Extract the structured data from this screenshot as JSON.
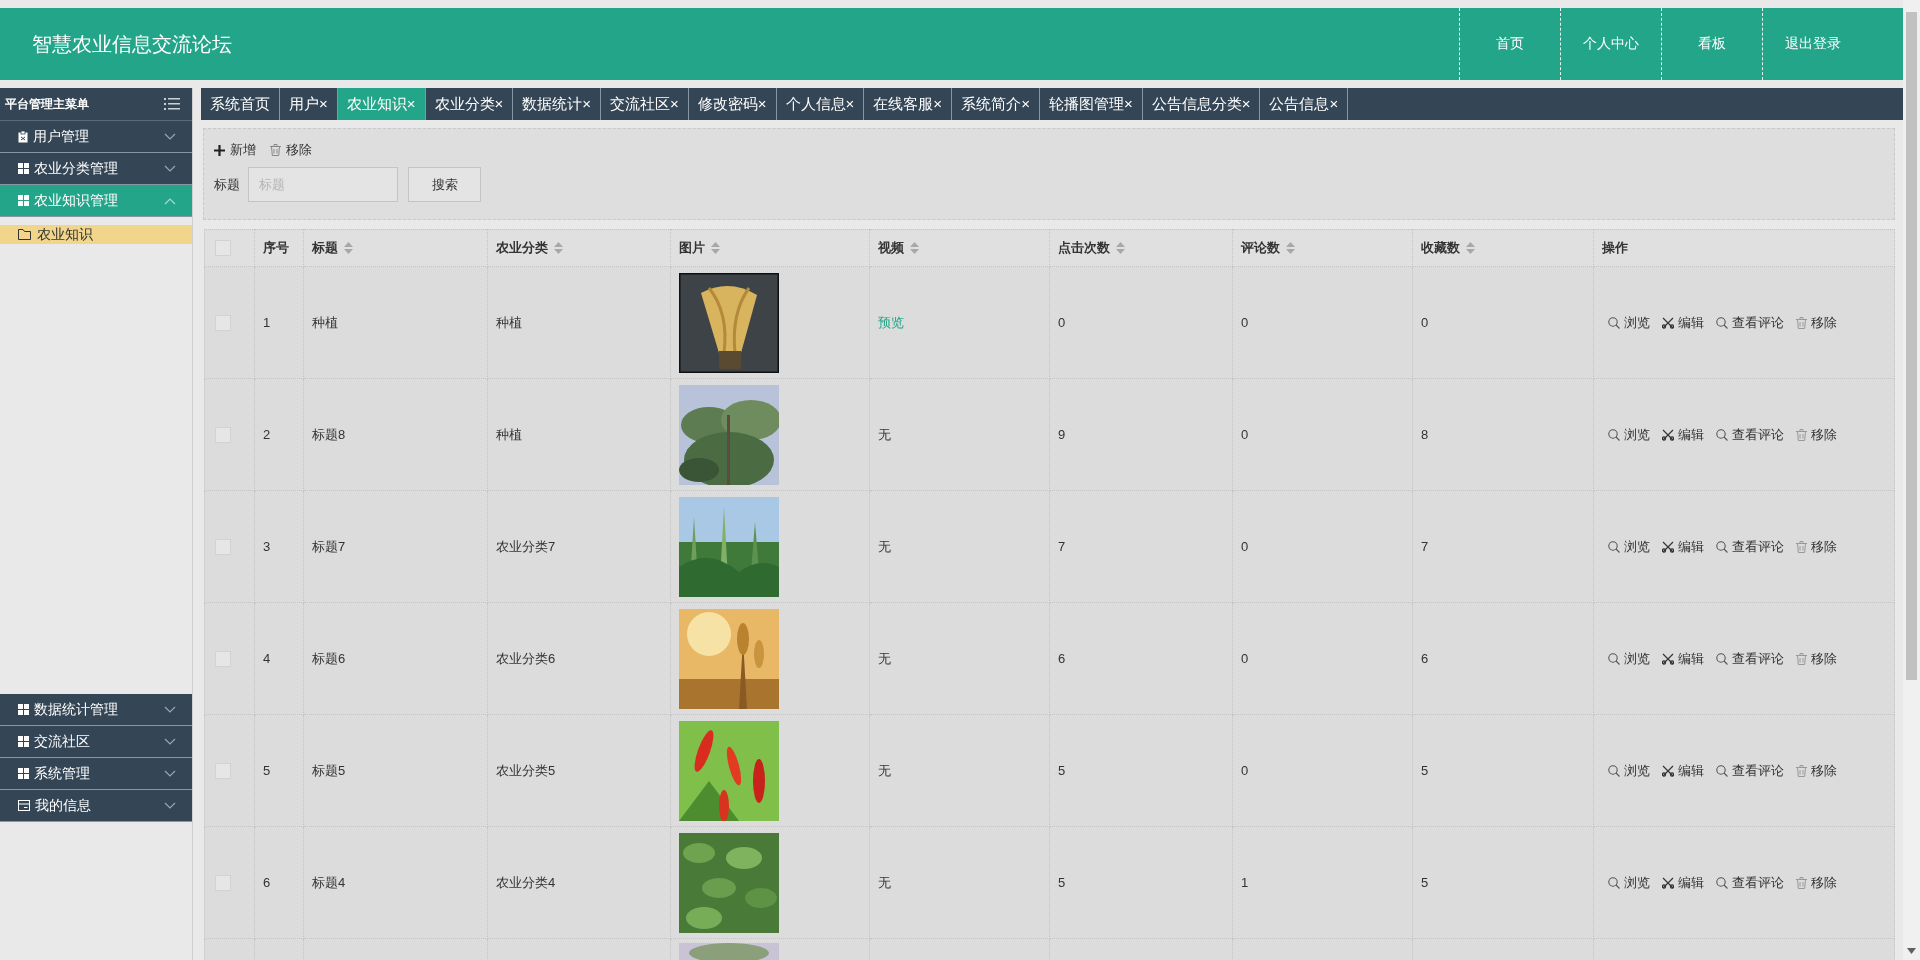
{
  "header": {
    "title": "智慧农业信息交流论坛",
    "nav": [
      {
        "label": "首页"
      },
      {
        "label": "个人中心"
      },
      {
        "label": "看板"
      },
      {
        "label": "退出登录"
      }
    ]
  },
  "sidebar": {
    "title": "平台管理主菜单",
    "items": [
      {
        "label": "用户管理",
        "kind": "clipboard",
        "selected": false,
        "expanded": false
      },
      {
        "label": "农业分类管理",
        "kind": "grid",
        "selected": false,
        "expanded": false
      },
      {
        "label": "农业知识管理",
        "kind": "grid",
        "selected": true,
        "expanded": true,
        "children": [
          {
            "label": "农业知识",
            "selected": true
          }
        ]
      },
      {
        "label": "数据统计管理",
        "kind": "grid",
        "selected": false,
        "expanded": false
      },
      {
        "label": "交流社区",
        "kind": "grid",
        "selected": false,
        "expanded": false
      },
      {
        "label": "系统管理",
        "kind": "grid",
        "selected": false,
        "expanded": false
      },
      {
        "label": "我的信息",
        "kind": "card",
        "selected": false,
        "expanded": false
      }
    ]
  },
  "tabs": [
    {
      "label": "系统首页",
      "selected": false
    },
    {
      "label": "用户",
      "close": "×",
      "selected": false
    },
    {
      "label": "农业知识",
      "close": "×",
      "selected": true
    },
    {
      "label": "农业分类",
      "close": "×",
      "selected": false
    },
    {
      "label": "数据统计",
      "close": "×",
      "selected": false
    },
    {
      "label": "交流社区",
      "close": "×",
      "selected": false
    },
    {
      "label": "修改密码",
      "close": "×",
      "selected": false
    },
    {
      "label": "个人信息",
      "close": "×",
      "selected": false
    },
    {
      "label": "在线客服",
      "close": "×",
      "selected": false
    },
    {
      "label": "系统简介",
      "close": "×",
      "selected": false
    },
    {
      "label": "轮播图管理",
      "close": "×",
      "selected": false
    },
    {
      "label": "公告信息分类",
      "close": "×",
      "selected": false
    },
    {
      "label": "公告信息",
      "close": "×",
      "selected": false
    }
  ],
  "toolbar": {
    "buttons": [
      {
        "label": "新增",
        "kind": "add"
      },
      {
        "label": "移除",
        "kind": "delete"
      }
    ],
    "search_label": "标题",
    "search_field": {
      "placeholder": "标题"
    },
    "search_button": "搜索"
  },
  "table": {
    "header_checked": false,
    "columns": [
      {
        "label": "序号",
        "sortable": false
      },
      {
        "label": "标题",
        "sortable": true
      },
      {
        "label": "农业分类",
        "sortable": true
      },
      {
        "label": "图片",
        "sortable": true
      },
      {
        "label": "视频",
        "sortable": true
      },
      {
        "label": "点击次数",
        "sortable": true
      },
      {
        "label": "评论数",
        "sortable": true
      },
      {
        "label": "收藏数",
        "sortable": true
      },
      {
        "label": "操作",
        "sortable": false
      }
    ],
    "rows": [
      {
        "checked": false,
        "no": "1",
        "title": "种植",
        "category": "种植",
        "image": {
          "kind": "picture"
        },
        "video": {
          "text": "预览",
          "kind": "link"
        },
        "clicks": "0",
        "comments": "0",
        "favorites": "0",
        "actions": [
          {
            "label": "浏览",
            "kind": "view"
          },
          {
            "label": "编辑",
            "kind": "edit"
          },
          {
            "label": "查看评论",
            "kind": "view"
          },
          {
            "label": "移除",
            "kind": "delete"
          }
        ]
      },
      {
        "checked": false,
        "no": "2",
        "title": "标题8",
        "category": "种植",
        "image": {
          "kind": "picture"
        },
        "video": {
          "text": "无",
          "kind": "plain"
        },
        "clicks": "9",
        "comments": "0",
        "favorites": "8",
        "actions": [
          {
            "label": "浏览",
            "kind": "view"
          },
          {
            "label": "编辑",
            "kind": "edit"
          },
          {
            "label": "查看评论",
            "kind": "view"
          },
          {
            "label": "移除",
            "kind": "delete"
          }
        ]
      },
      {
        "checked": false,
        "no": "3",
        "title": "标题7",
        "category": "农业分类7",
        "image": {
          "kind": "picture"
        },
        "video": {
          "text": "无",
          "kind": "plain"
        },
        "clicks": "7",
        "comments": "0",
        "favorites": "7",
        "actions": [
          {
            "label": "浏览",
            "kind": "view"
          },
          {
            "label": "编辑",
            "kind": "edit"
          },
          {
            "label": "查看评论",
            "kind": "view"
          },
          {
            "label": "移除",
            "kind": "delete"
          }
        ]
      },
      {
        "checked": false,
        "no": "4",
        "title": "标题6",
        "category": "农业分类6",
        "image": {
          "kind": "picture"
        },
        "video": {
          "text": "无",
          "kind": "plain"
        },
        "clicks": "6",
        "comments": "0",
        "favorites": "6",
        "actions": [
          {
            "label": "浏览",
            "kind": "view"
          },
          {
            "label": "编辑",
            "kind": "edit"
          },
          {
            "label": "查看评论",
            "kind": "view"
          },
          {
            "label": "移除",
            "kind": "delete"
          }
        ]
      },
      {
        "checked": false,
        "no": "5",
        "title": "标题5",
        "category": "农业分类5",
        "image": {
          "kind": "picture"
        },
        "video": {
          "text": "无",
          "kind": "plain"
        },
        "clicks": "5",
        "comments": "0",
        "favorites": "5",
        "actions": [
          {
            "label": "浏览",
            "kind": "view"
          },
          {
            "label": "编辑",
            "kind": "edit"
          },
          {
            "label": "查看评论",
            "kind": "view"
          },
          {
            "label": "移除",
            "kind": "delete"
          }
        ]
      },
      {
        "checked": false,
        "no": "6",
        "title": "标题4",
        "category": "农业分类4",
        "image": {
          "kind": "picture"
        },
        "video": {
          "text": "无",
          "kind": "plain"
        },
        "clicks": "5",
        "comments": "1",
        "favorites": "5",
        "actions": [
          {
            "label": "浏览",
            "kind": "view"
          },
          {
            "label": "编辑",
            "kind": "edit"
          },
          {
            "label": "查看评论",
            "kind": "view"
          },
          {
            "label": "移除",
            "kind": "delete"
          }
        ]
      },
      {
        "image": {
          "kind": "picture"
        }
      }
    ]
  }
}
